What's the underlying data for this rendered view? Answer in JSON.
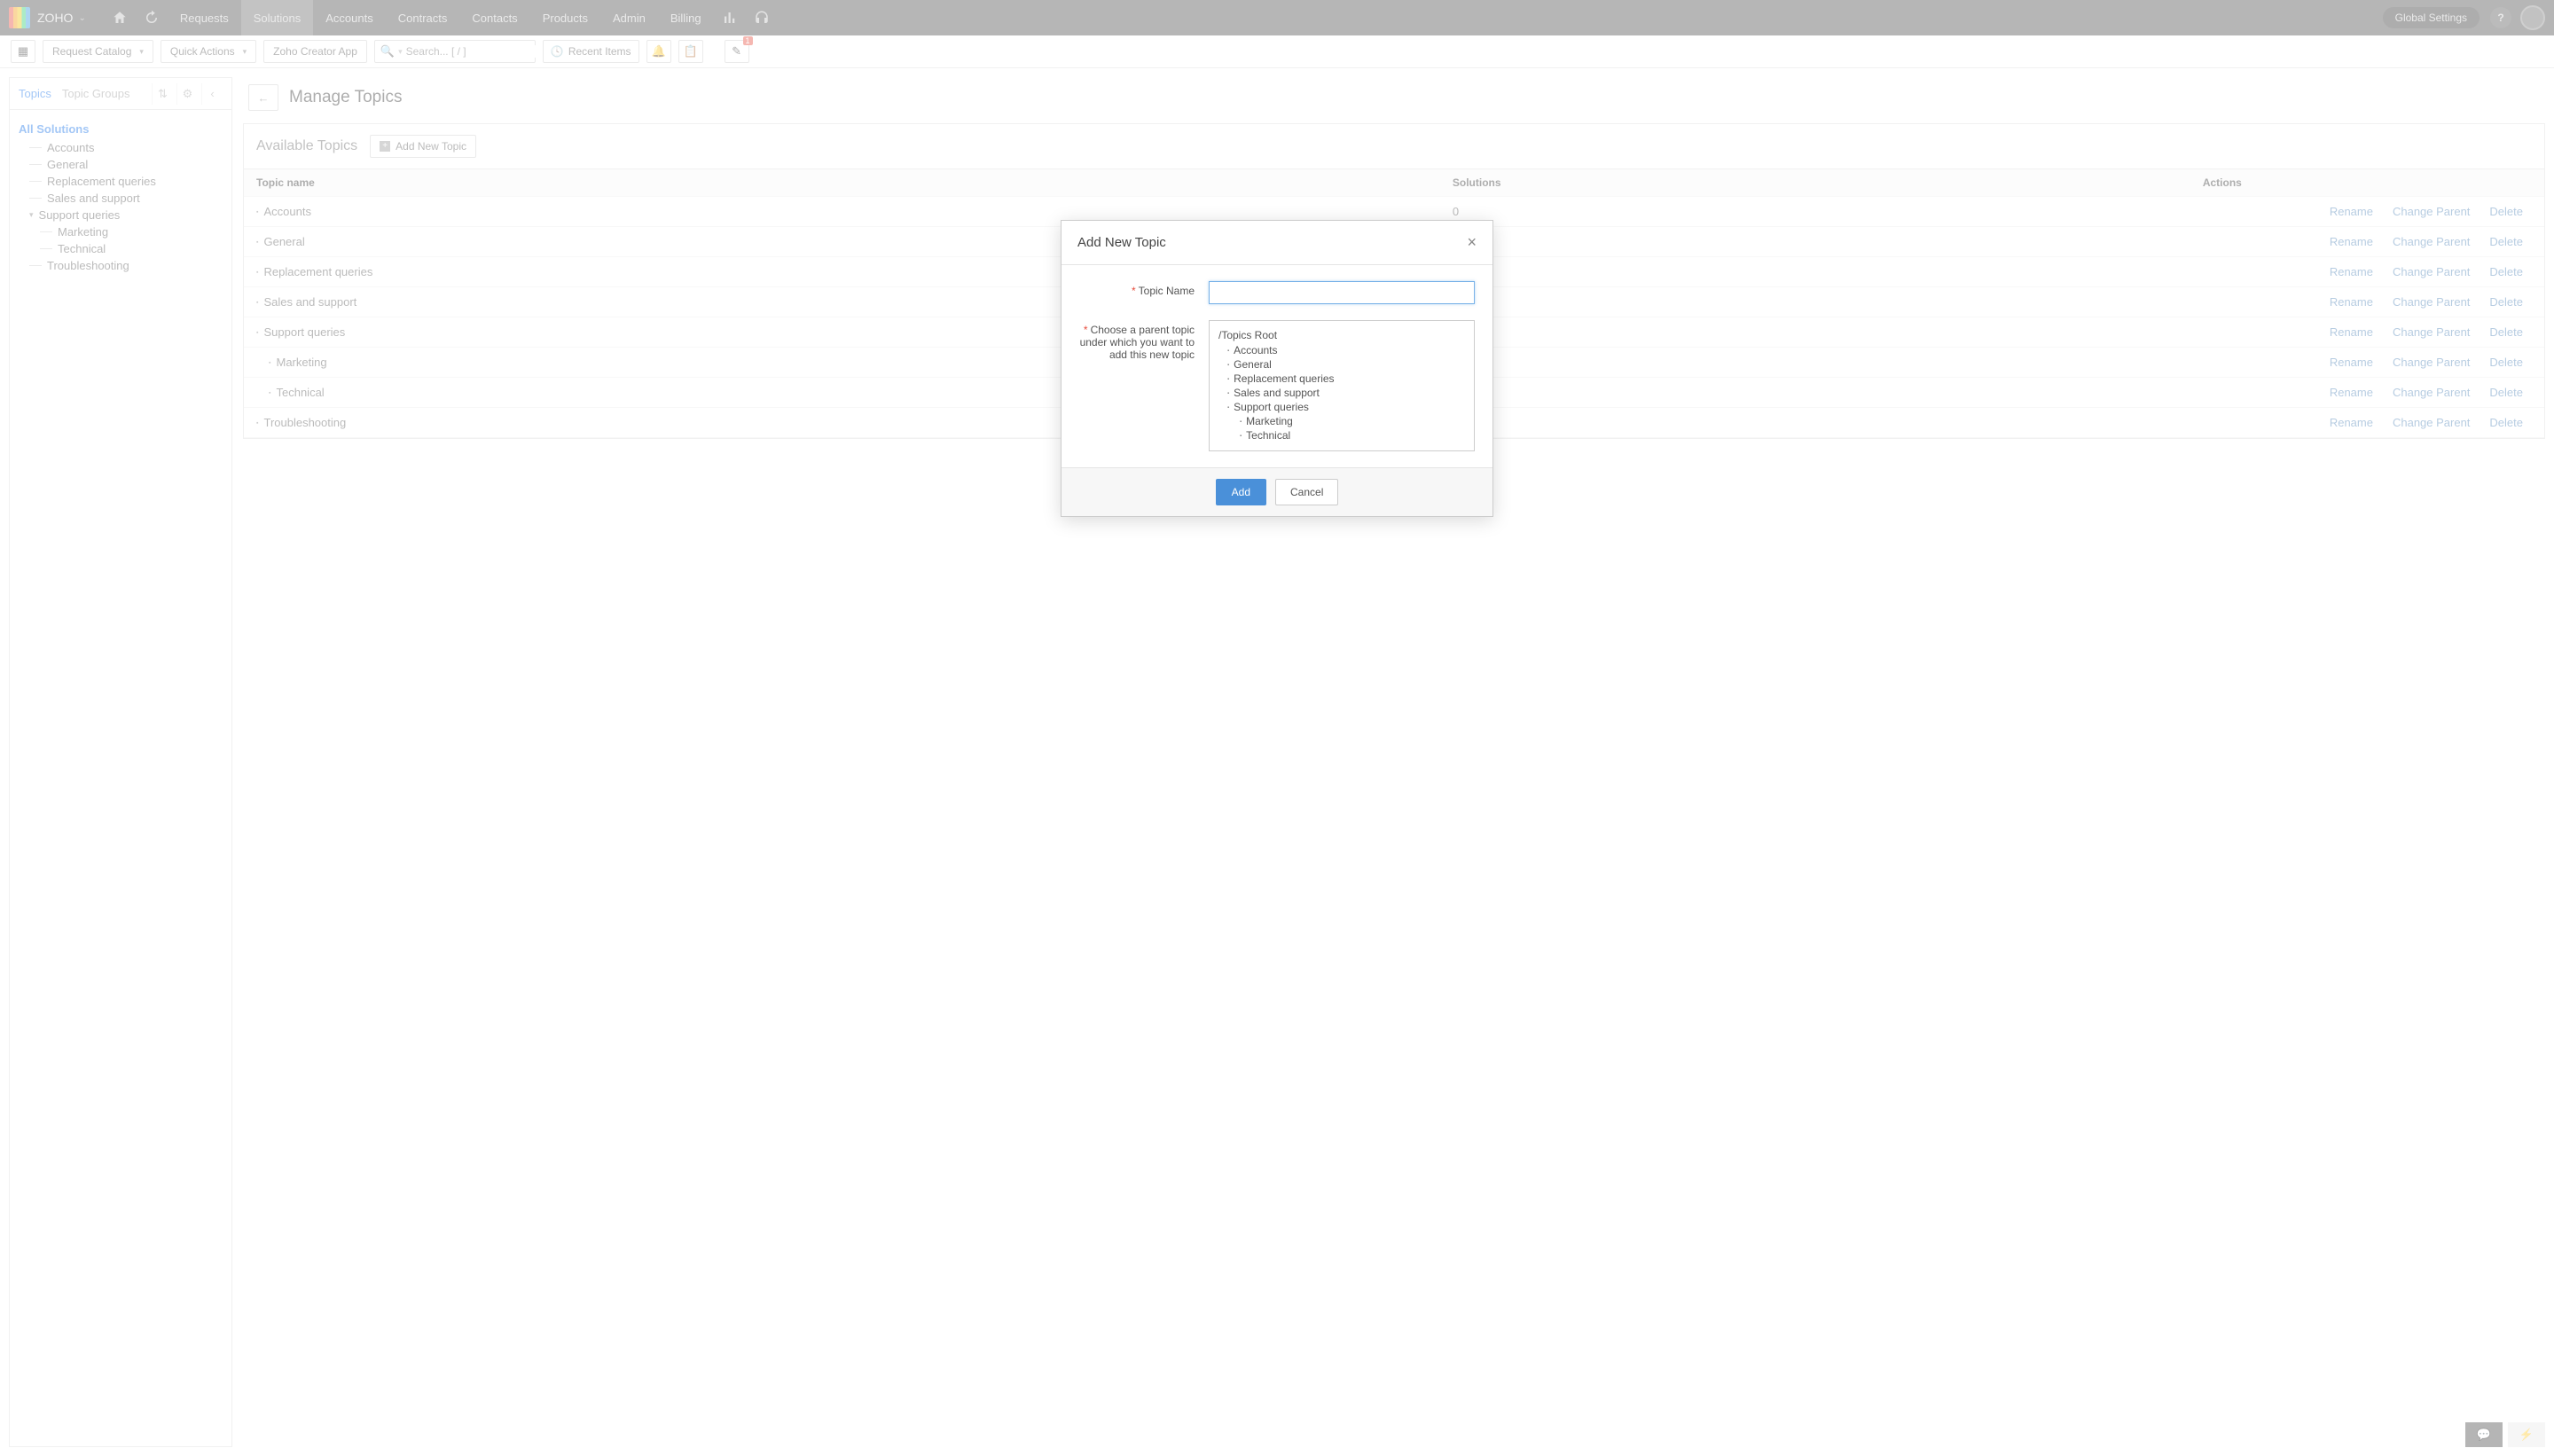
{
  "header": {
    "brand": "ZOHO",
    "nav": [
      "Requests",
      "Solutions",
      "Accounts",
      "Contracts",
      "Contacts",
      "Products",
      "Admin",
      "Billing"
    ],
    "active_nav": "Solutions",
    "global_settings": "Global Settings"
  },
  "subheader": {
    "request_catalog": "Request Catalog",
    "quick_actions": "Quick Actions",
    "creator_app": "Zoho Creator App",
    "search_placeholder": "Search... [ / ]",
    "recent_items": "Recent Items",
    "badge": "1"
  },
  "sidebar": {
    "tabs": [
      "Topics",
      "Topic Groups"
    ],
    "all_solutions": "All Solutions",
    "tree": [
      {
        "label": "Accounts",
        "children": []
      },
      {
        "label": "General",
        "children": []
      },
      {
        "label": "Replacement queries",
        "children": []
      },
      {
        "label": "Sales and support",
        "children": []
      },
      {
        "label": "Support queries",
        "children": [
          {
            "label": "Marketing"
          },
          {
            "label": "Technical"
          }
        ]
      },
      {
        "label": "Troubleshooting",
        "children": []
      }
    ]
  },
  "page": {
    "title": "Manage Topics",
    "available_title": "Available Topics",
    "add_new": "Add New Topic",
    "columns": {
      "name": "Topic name",
      "solutions": "Solutions",
      "actions": "Actions"
    },
    "actions": {
      "rename": "Rename",
      "change": "Change Parent",
      "delete": "Delete"
    },
    "rows": [
      {
        "name": "Accounts",
        "indent": 0,
        "solutions": "0"
      },
      {
        "name": "General",
        "indent": 0,
        "solutions": ""
      },
      {
        "name": "Replacement queries",
        "indent": 0,
        "solutions": ""
      },
      {
        "name": "Sales and support",
        "indent": 0,
        "solutions": ""
      },
      {
        "name": "Support queries",
        "indent": 0,
        "solutions": ""
      },
      {
        "name": "Marketing",
        "indent": 1,
        "solutions": ""
      },
      {
        "name": "Technical",
        "indent": 1,
        "solutions": ""
      },
      {
        "name": "Troubleshooting",
        "indent": 0,
        "solutions": ""
      }
    ]
  },
  "modal": {
    "title": "Add New Topic",
    "topic_name_label": "Topic Name",
    "parent_label": "Choose a parent topic under which you want to add this new topic",
    "root": "/Topics Root",
    "tree": [
      {
        "label": "Accounts",
        "level": 2
      },
      {
        "label": "General",
        "level": 2
      },
      {
        "label": "Replacement queries",
        "level": 2
      },
      {
        "label": "Sales and support",
        "level": 2
      },
      {
        "label": "Support queries",
        "level": 2
      },
      {
        "label": "Marketing",
        "level": 3
      },
      {
        "label": "Technical",
        "level": 3
      }
    ],
    "add": "Add",
    "cancel": "Cancel"
  }
}
